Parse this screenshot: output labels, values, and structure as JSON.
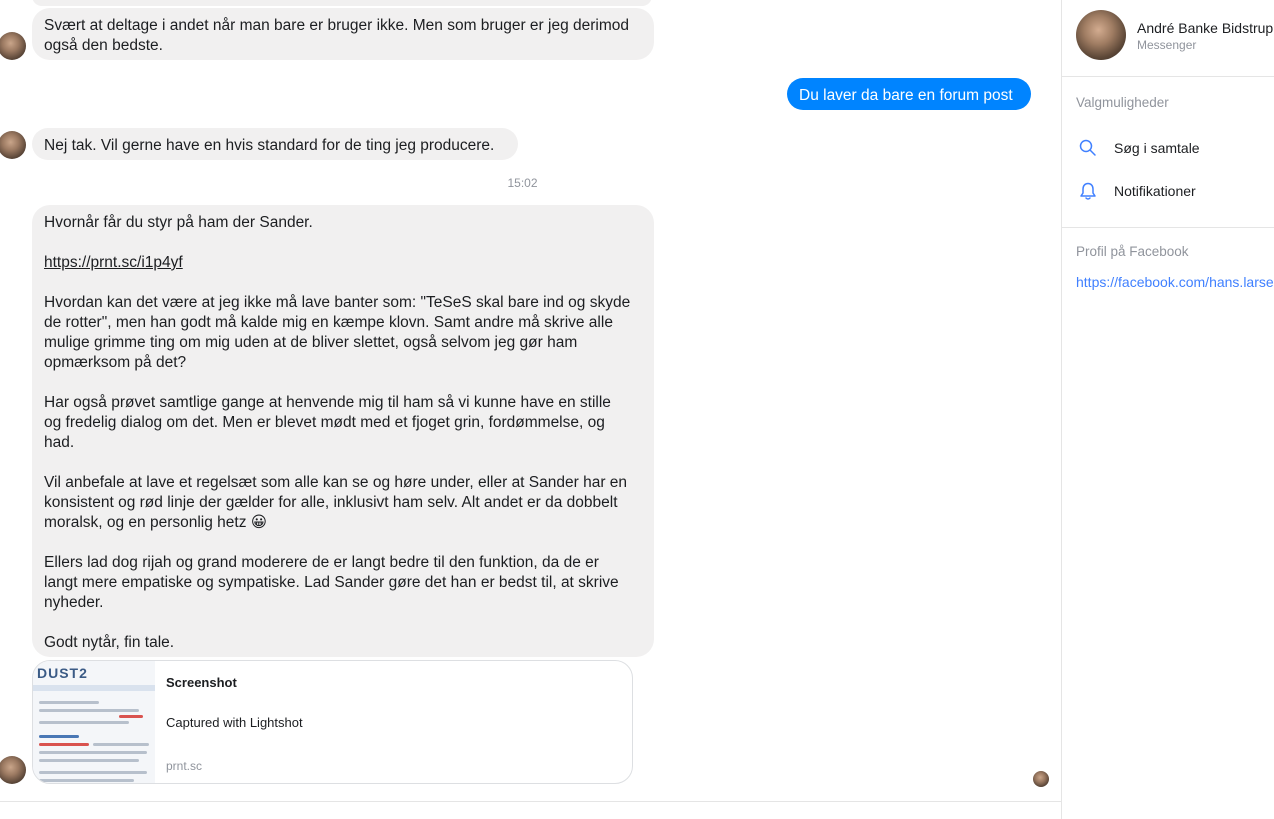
{
  "conversation": {
    "messages": [
      {
        "text": "Svært at deltage i andet når man bare er bruger ikke. Men som bruger er jeg derimod også den bedste."
      },
      {
        "text": "Du laver da bare en forum post"
      },
      {
        "text": "Nej tak. Vil gerne have en hvis standard for de ting jeg producere."
      }
    ],
    "timestamp": "15:02",
    "long_message": {
      "p1": "Hvornår får du styr på ham der Sander.",
      "link": "https://prnt.sc/i1p4yf",
      "p2": "Hvordan kan det være at jeg ikke må lave banter som: \"TeSeS skal bare ind og skyde\nde rotter\", men han godt må kalde mig en kæmpe klovn. Samt andre må skrive alle\nmulige grimme ting om mig uden at de bliver slettet, også selvom jeg gør ham\nopmærksom på det?",
      "p3": "Har også prøvet samtlige gange at henvende mig til ham så vi kunne have en stille\nog fredelig dialog om det. Men er blevet mødt med et fjoget grin, fordømmelse, og\nhad.",
      "p4": "Vil anbefale at lave et regelsæt som alle kan se og høre under, eller at Sander har en\nkonsistent og rød linje der gælder for alle, inklusivt ham selv. Alt andet er da dobbelt\nmoralsk, og en personlig hetz ",
      "emoji": "😀",
      "p5": "Ellers lad dog rijah og grand moderere de er langt bedre til den funktion, da de er\nlangt mere empatiske og sympatiske. Lad Sander gøre det han er bedst til, at skrive\nnyheder.",
      "p6": "Godt nytår, fin tale."
    },
    "share_card": {
      "thumb_logo": "DUST2",
      "title": "Screenshot",
      "description": "Captured with Lightshot",
      "domain": "prnt.sc"
    }
  },
  "sidebar": {
    "name": "André Banke Bidstrup",
    "subtitle": "Messenger",
    "options_label": "Valgmuligheder",
    "options": [
      {
        "label": "Søg i samtale",
        "icon": "search-icon"
      },
      {
        "label": "Notifikationer",
        "icon": "bell-icon"
      }
    ],
    "profile_label": "Profil på Facebook",
    "profile_link": "https://facebook.com/hans.larsen"
  },
  "colors": {
    "outgoing_bubble": "#0084ff",
    "incoming_bubble": "#f1f0f0",
    "link_blue": "#4080ff"
  }
}
